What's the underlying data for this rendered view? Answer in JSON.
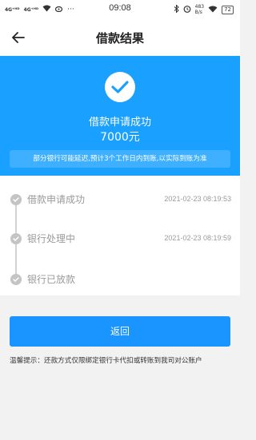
{
  "status_bar": {
    "signal_1": "4G⁺ᴴᴰ",
    "signal_2": "4G⁺ᴴᴰ",
    "time": "09:08",
    "speed_value": "483",
    "speed_unit": "B/s",
    "battery": "72",
    "icons": [
      "signal-icon",
      "wifi-icon",
      "weibo-icon",
      "more-icon",
      "bluetooth-icon",
      "alarm-icon",
      "battery-icon"
    ]
  },
  "nav": {
    "title": "借款结果",
    "back_icon": "arrow-left-icon"
  },
  "hero": {
    "status": "借款申请成功",
    "amount": "7000元",
    "notice": "部分银行可能延迟,预计3个工作日内到账,以实际到账为准",
    "color": "#1aa0ff"
  },
  "timeline": {
    "steps": [
      {
        "label": "借款申请成功",
        "time": "2021-02-23 08:19:53"
      },
      {
        "label": "银行处理中",
        "time": "2021-02-23 08:19:59"
      },
      {
        "label": "银行已放款",
        "time": ""
      }
    ]
  },
  "actions": {
    "return_label": "返回",
    "button_color": "#1a94ff"
  },
  "tip": "温馨提示：还款方式仅限绑定银行卡代扣或转账到我司对公账户"
}
